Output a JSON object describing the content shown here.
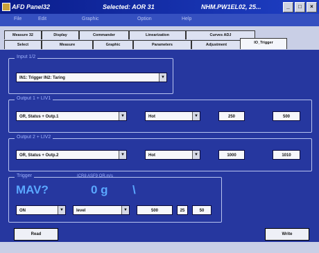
{
  "window": {
    "title": "AFD Panel32",
    "selected_label": "Selected: AOR 31",
    "path": "NHM.PW1EL02, 25..."
  },
  "menu": [
    "File",
    "Edit",
    "Graphic",
    "Option",
    "Help"
  ],
  "tabs_row1": [
    "Measure 32",
    "Display",
    "Commander",
    "Linearization",
    "Curves ADJ"
  ],
  "tabs_row2": [
    "Select",
    "Measure",
    "Graphic",
    "Parameters",
    "Adjustment",
    "IO_Trigger"
  ],
  "active_tab": "IO_Trigger",
  "input_group": {
    "label": "Input 1/2",
    "value": "IN1: Trigger  IN2: Taring"
  },
  "output1": {
    "label": "Output 1 + LIV1",
    "mode": "OR, Status + Outp.1",
    "polarity": "Hot",
    "val1": "250",
    "val2": "500"
  },
  "output2": {
    "label": "Output 2 + LIV2",
    "mode": "OR, Status + Outp.2",
    "polarity": "Hot",
    "val1": "1000",
    "val2": "1010"
  },
  "trigger": {
    "label": "Trigger",
    "header": "ICR8  ASF9 OR.m/s",
    "reading_name": "MAV?",
    "reading_value": "0 g",
    "reading_sign": "\\",
    "state": "ON",
    "level": "level",
    "f1": "500",
    "f2": "25",
    "f3": "50"
  },
  "buttons": {
    "read": "Read",
    "write": "Write"
  }
}
